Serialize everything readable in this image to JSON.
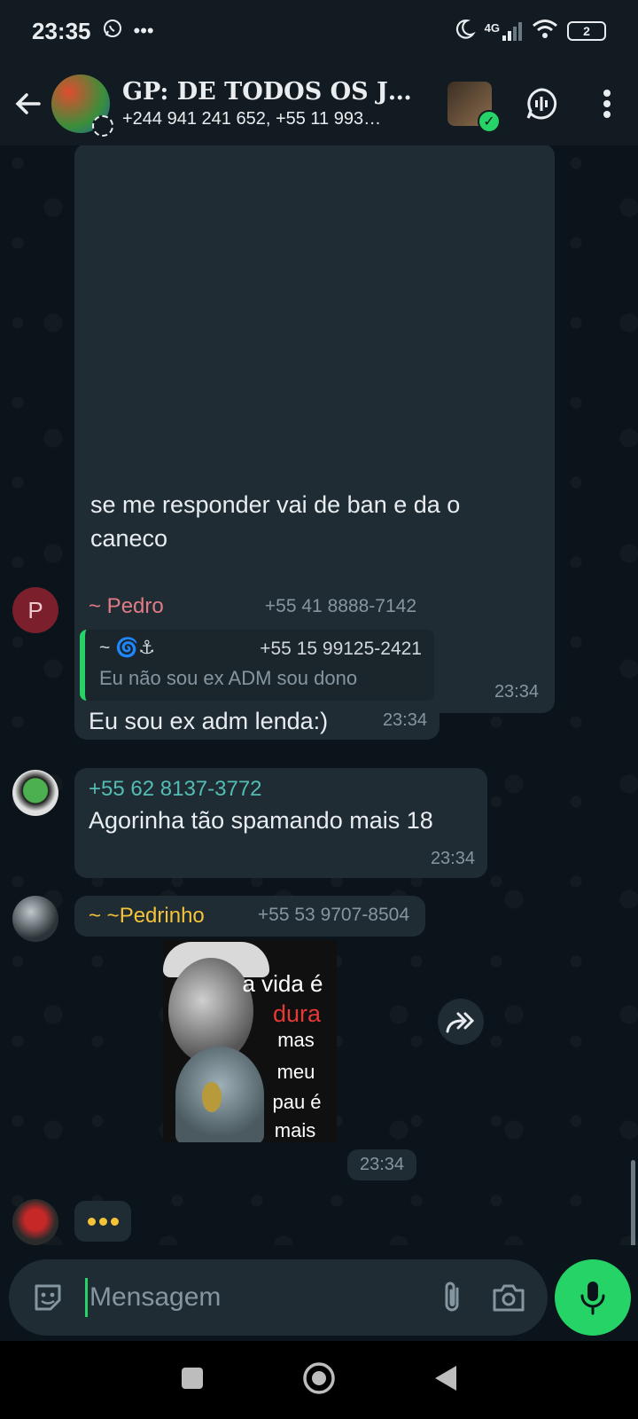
{
  "status_bar": {
    "time": "23:35",
    "network": "4G",
    "battery": "2"
  },
  "header": {
    "title": "GP: DE TODOS OS J…",
    "subtitle": "+244 941 241 652, +55 11 993…"
  },
  "messages": {
    "m1": {
      "text": "se me responder vai de ban e da o caneco",
      "time": "23:34"
    },
    "m2": {
      "avatar_letter": "P",
      "sender": "~ Pedro",
      "phone": "+55 41 8888-7142",
      "quote_sender": "~ 🌀⚓",
      "quote_phone": "+55 15 99125-2421",
      "quote_text": "Eu não sou ex ADM sou dono",
      "text": "Eu sou ex adm lenda:)",
      "time": "23:34"
    },
    "m3": {
      "sender": "+55 62 8137-3772",
      "text": "Agorinha tão spamando mais 18",
      "time": "23:34"
    },
    "m4": {
      "sender": "~ ~Pedrinho",
      "phone": "+55 53 9707-8504",
      "sticker_lines": [
        "a vida é",
        "dura",
        "mas",
        "meu",
        "pau é",
        "mais"
      ],
      "time": "23:34"
    }
  },
  "input": {
    "placeholder": "Mensagem"
  },
  "colors": {
    "accent": "#25d366",
    "bubble": "#1f2c34",
    "background": "#0b141a",
    "pedro_name": "#e37b86",
    "phone_sender": "#53bdb5",
    "pedrinho_name": "#f5c338"
  }
}
